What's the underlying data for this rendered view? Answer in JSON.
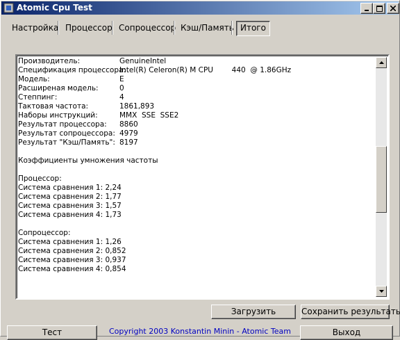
{
  "window": {
    "title": "Atomic Cpu Test"
  },
  "tabs": [
    {
      "label": "Настройка"
    },
    {
      "label": "Процессор"
    },
    {
      "label": "Сопроцессор"
    },
    {
      "label": "Кэш/Память"
    },
    {
      "label": "Итого",
      "active": true
    }
  ],
  "summary": {
    "rows": [
      {
        "label": "Производитель:",
        "value": "GenuineIntel"
      },
      {
        "label": "Спецификация процессора:",
        "value": "Intel(R) Celeron(R) M CPU        440  @ 1.86GHz"
      },
      {
        "label": "Модель:",
        "value": "E"
      },
      {
        "label": "Расширеная модель:",
        "value": "0"
      },
      {
        "label": "Степпинг:",
        "value": "4"
      },
      {
        "label": "Тактовая частота:",
        "value": "1861,893"
      },
      {
        "label": "Наборы инструкций:",
        "value": "MMX  SSE  SSE2"
      },
      {
        "label": "Результат процессора:",
        "value": "8860"
      },
      {
        "label": "Результат сопроцессора:",
        "value": "4979"
      },
      {
        "label": "Результат \"Кэш/Память\":",
        "value": "8197"
      }
    ],
    "multipliers_title": "Коэффициенты умножения частоты",
    "cpu_title": "Процессор:",
    "cpu_lines": [
      "Система сравнения 1: 2,24",
      "Система сравнения 2: 1,77",
      "Система сравнения 3: 1,57",
      "Система сравнения 4: 1,73"
    ],
    "fpu_title": "Сопроцессор:",
    "fpu_lines": [
      "Система сравнения 1: 1,26",
      "Система сравнения 2: 0,852",
      "Система сравнения 3: 0,937",
      "Система сравнения 4: 0,854"
    ]
  },
  "buttons": {
    "load": "Загрузить",
    "save": "Сохранить результаты",
    "test": "Тест",
    "exit": "Выход"
  },
  "footer": {
    "copyright": "Copyright 2003 Konstantin Minin - Atomic Team"
  }
}
